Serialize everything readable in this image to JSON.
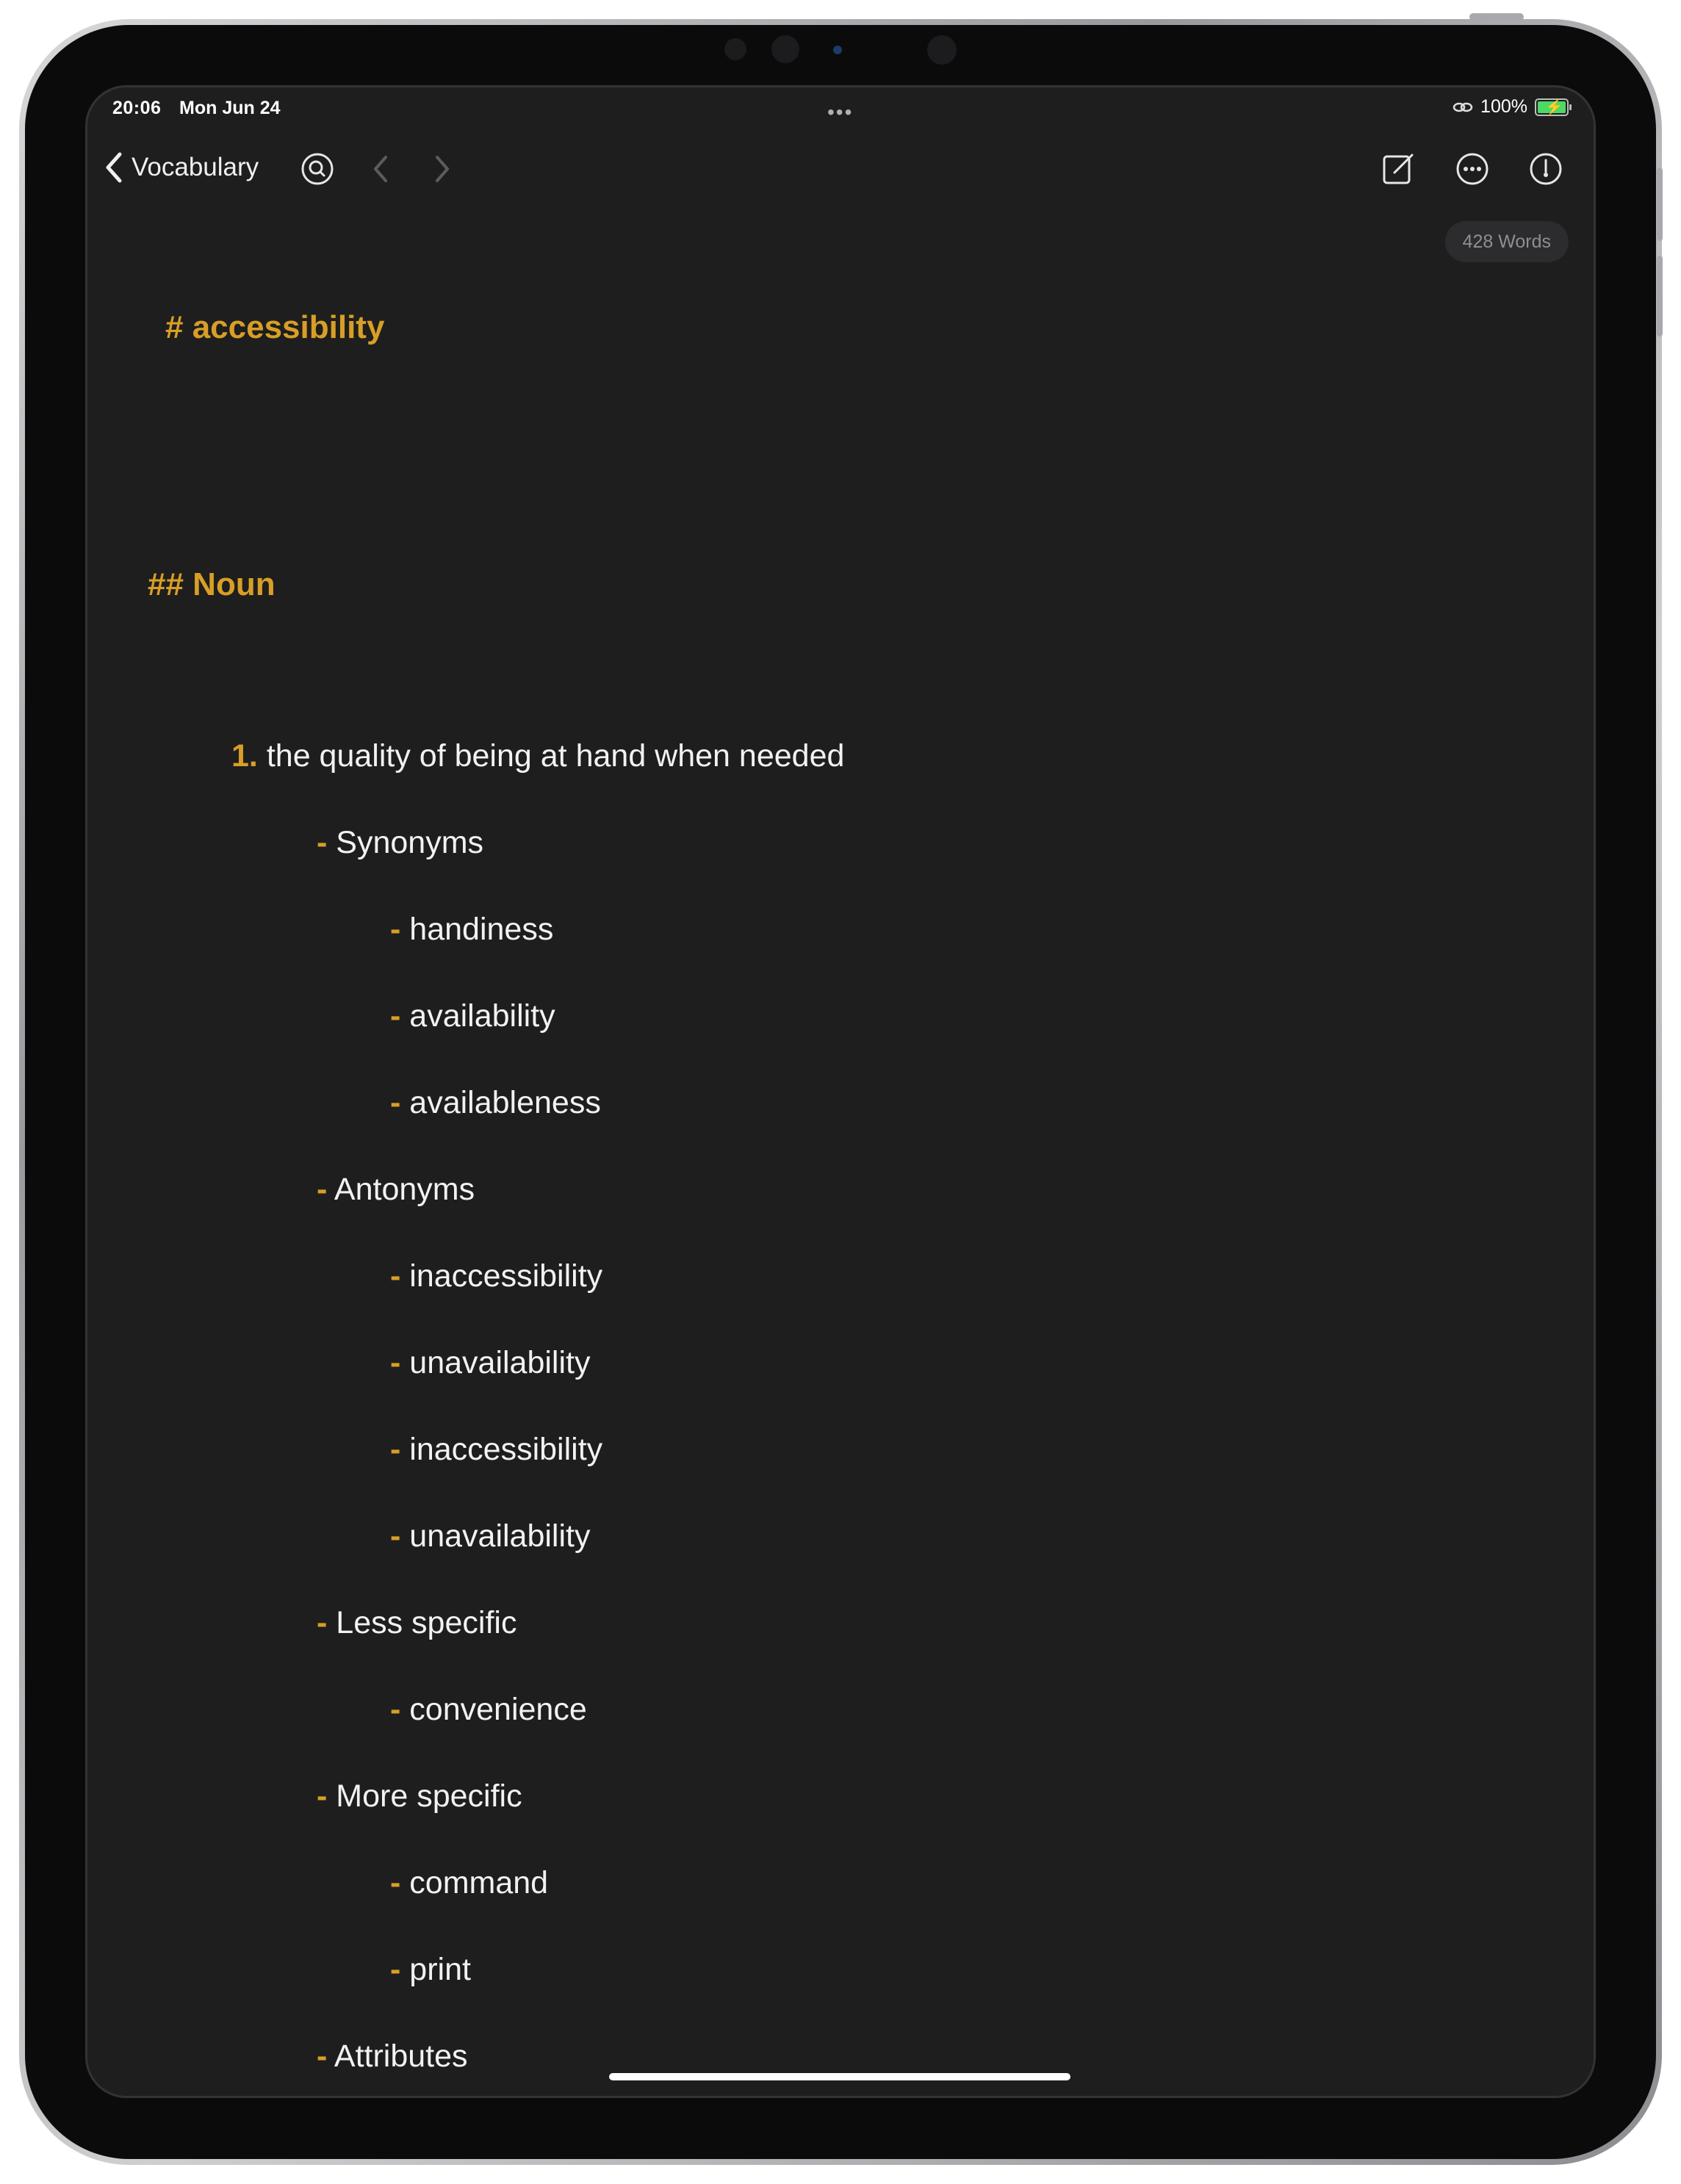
{
  "status": {
    "time": "20:06",
    "date": "Mon Jun 24",
    "battery": "100%"
  },
  "toolbar": {
    "back_label": "Vocabulary"
  },
  "word_count": "428 Words",
  "document": {
    "h1": "# accessibility",
    "h2": "## Noun",
    "definition_number": "1.",
    "definition": "the quality of being at hand when needed",
    "bullet": "-",
    "synonyms_label": "Synonyms",
    "synonyms": [
      "handiness",
      "availability",
      "availableness"
    ],
    "antonyms_label": "Antonyms",
    "antonyms": [
      "inaccessibility",
      "unavailability",
      "inaccessibility",
      "unavailability"
    ],
    "less_specific_label": "Less specific",
    "less_specific": [
      "convenience"
    ],
    "more_specific_label": "More specific",
    "more_specific": [
      "command",
      "print"
    ],
    "attributes_label": "Attributes"
  },
  "colors": {
    "accent": "#d89e26",
    "background": "#1e1e1e",
    "text": "#f2f2f2"
  }
}
